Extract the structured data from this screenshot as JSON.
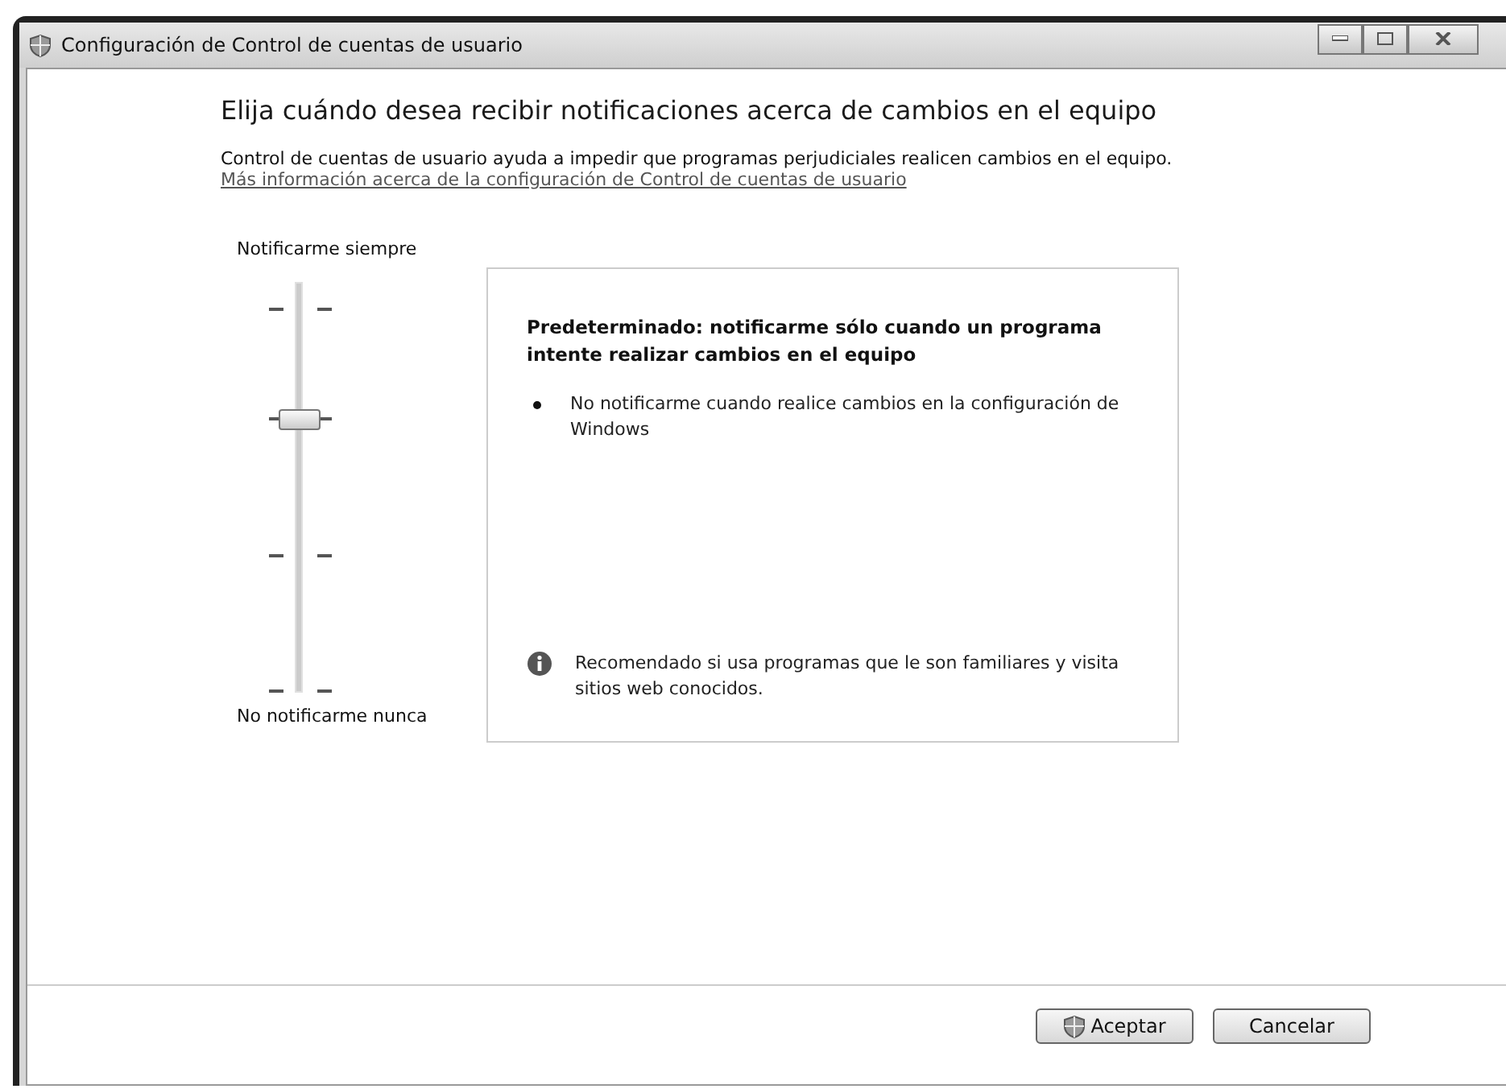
{
  "window": {
    "title": "Configuración de Control de cuentas de usuario"
  },
  "heading": "Elija cuándo desea recibir notificaciones acerca de cambios en el equipo",
  "description": "Control de cuentas de usuario ayuda a impedir que programas perjudiciales realicen cambios en el equipo.",
  "link": "Más información acerca de la configuración de Control de cuentas de usuario",
  "slider": {
    "top_label": "Notificarme siempre",
    "bottom_label": "No notificarme nunca",
    "level": 0.667
  },
  "info": {
    "title": "Predeterminado: notificarme sólo cuando un programa intente realizar cambios en el equipo",
    "bullets": [
      "No notificarme cuando realice cambios en la configuración de Windows"
    ],
    "note": "Recomendado si usa programas que le son familiares y visita sitios web conocidos."
  },
  "buttons": [
    {
      "label": "Aceptar",
      "shield": true
    },
    {
      "label": "Cancelar",
      "shield": false
    }
  ]
}
